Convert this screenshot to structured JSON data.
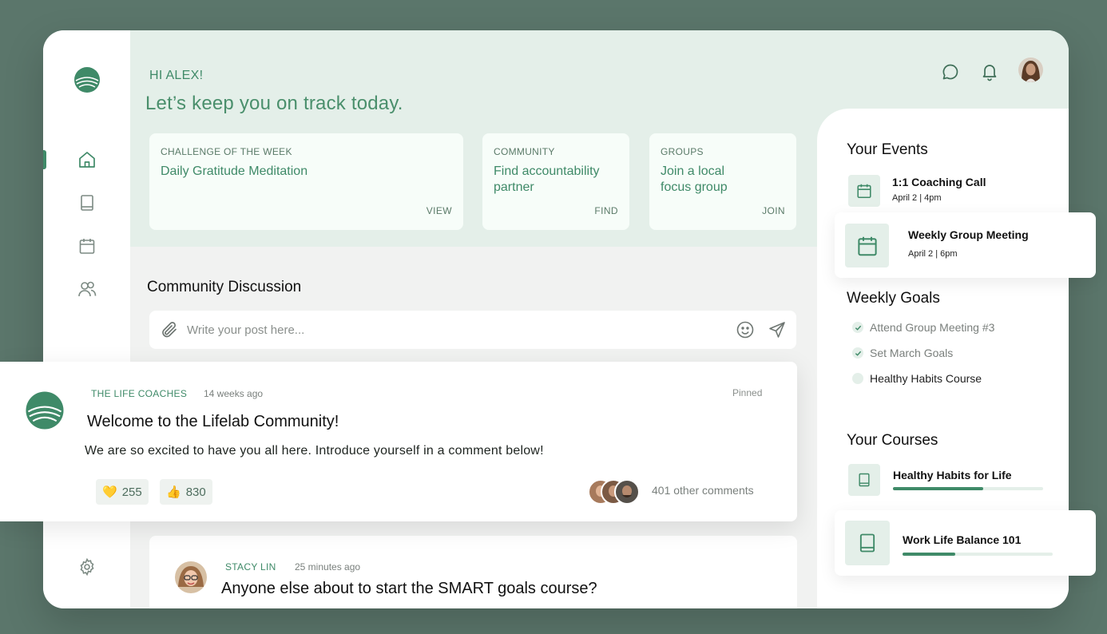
{
  "header": {
    "greeting": "HI ALEX!",
    "tagline": "Let’s keep you on track today."
  },
  "highlights": [
    {
      "category": "CHALLENGE OF THE WEEK",
      "title": "Daily Gratitude Meditation",
      "action": "VIEW"
    },
    {
      "category": "COMMUNITY",
      "title": "Find accountability partner",
      "action": "FIND"
    },
    {
      "category": "GROUPS",
      "title": "Join a local focus group",
      "action": "JOIN"
    }
  ],
  "sidebar": {
    "items": [
      {
        "icon": "home-icon"
      },
      {
        "icon": "book-icon"
      },
      {
        "icon": "calendar-icon"
      },
      {
        "icon": "users-icon"
      }
    ],
    "settings_icon": "gear-icon"
  },
  "discussion": {
    "title": "Community Discussion",
    "composer_placeholder": "Write your post here..."
  },
  "posts": [
    {
      "author": "THE LIFE COACHES",
      "time": "14 weeks ago",
      "pinned": "Pinned",
      "title": "Welcome to the Lifelab Community!",
      "body": "We are so excited to have you all here. Introduce yourself in a comment below!",
      "reactions": [
        {
          "emoji": "💛",
          "count": "255"
        },
        {
          "emoji": "👍",
          "count": "830"
        }
      ],
      "comments": "401 other comments"
    },
    {
      "author": "STACY LIN",
      "time": "25 minutes ago",
      "title": "Anyone else about to start the SMART goals course?"
    }
  ],
  "events": {
    "title": "Your Events",
    "items": [
      {
        "title": "1:1 Coaching Call",
        "date": "April 2 | 4pm"
      },
      {
        "title": "Weekly Group Meeting",
        "date": "April 2 | 6pm"
      }
    ]
  },
  "goals": {
    "title": "Weekly Goals",
    "items": [
      {
        "label": "Attend Group Meeting #3",
        "done": true
      },
      {
        "label": "Set March Goals",
        "done": true
      },
      {
        "label": "Healthy Habits Course",
        "done": false
      }
    ]
  },
  "courses": {
    "title": "Your Courses",
    "items": [
      {
        "title": "Healthy Habits for Life",
        "progress": 0.6
      },
      {
        "title": "Work Life Balance 101",
        "progress": 0.35
      }
    ]
  },
  "colors": {
    "accent": "#3f8a68",
    "background": "#5b766b",
    "hero": "#e4efe9"
  }
}
